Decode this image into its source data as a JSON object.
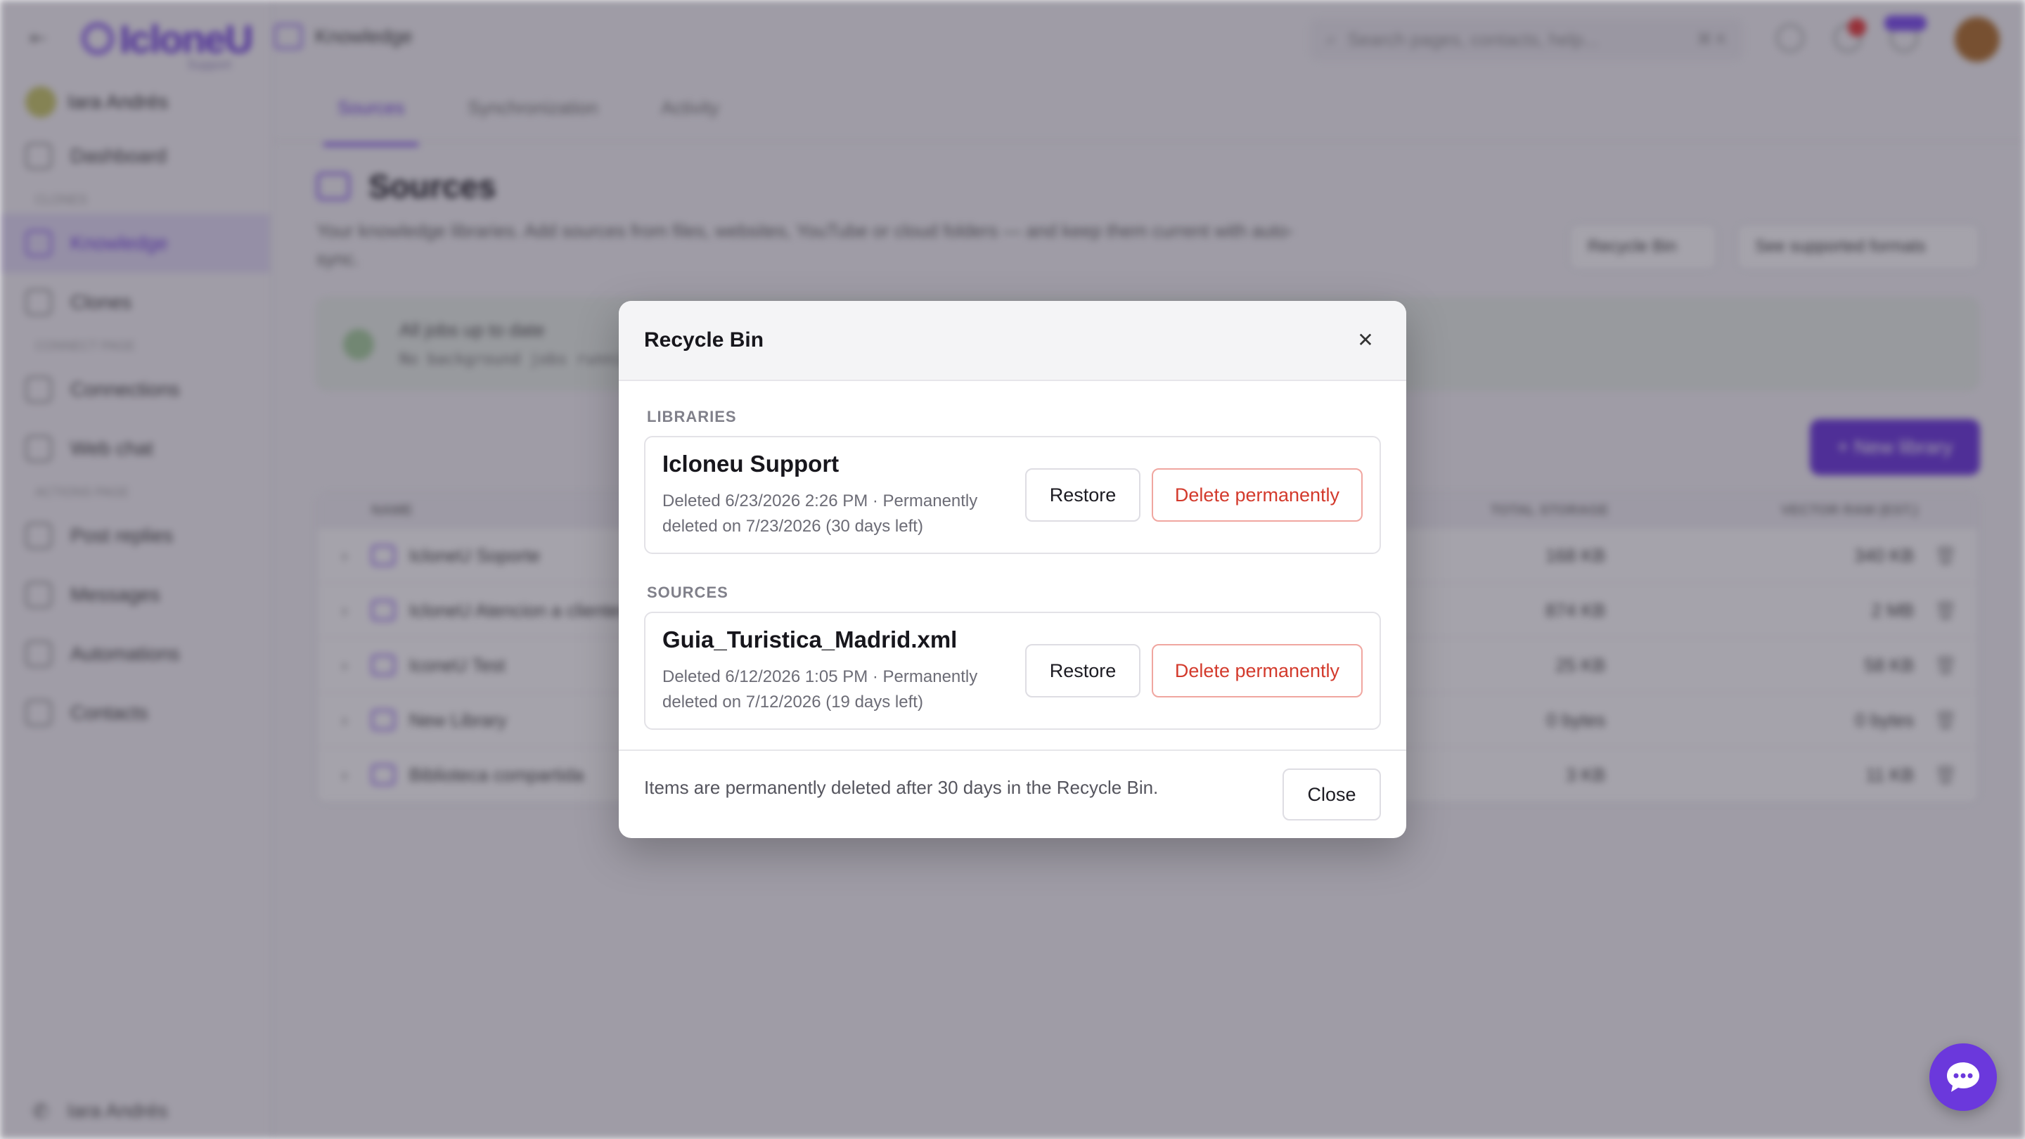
{
  "modal": {
    "title": "Recycle Bin",
    "libraries_label": "LIBRARIES",
    "sources_label": "SOURCES",
    "libraries": [
      {
        "name": "Icloneu Support",
        "meta": "Deleted 6/23/2026 2:26 PM · Permanently deleted on 7/23/2026 (30 days left)",
        "restore_label": "Restore",
        "delete_label": "Delete permanently"
      }
    ],
    "sources": [
      {
        "name": "Guia_Turistica_Madrid.xml",
        "meta": "Deleted 6/12/2026 1:05 PM · Permanently deleted on 7/12/2026 (19 days left)",
        "restore_label": "Restore",
        "delete_label": "Delete permanently"
      }
    ],
    "footer_note": "Items are permanently deleted after 30 days in the Recycle Bin.",
    "close_label": "Close"
  },
  "background": {
    "logo": "IcloneU",
    "logo_sub": "Support",
    "user": "Iara Andrés",
    "breadcrumb": "Knowledge",
    "search_placeholder": "Search pages, contacts, help...",
    "search_kbd": "⌘ K",
    "sidebar": {
      "dashboard": "Dashboard",
      "group_clones": "CLONES",
      "knowledge": "Knowledge",
      "clones": "Clones",
      "group_connect": "CONNECT PAGE",
      "connections": "Connections",
      "webchat": "Web chat",
      "group_actions": "ACTIONS PAGE",
      "post_replies": "Post replies",
      "messages": "Messages",
      "automations": "Automations",
      "contacts": "Contacts"
    },
    "tabs": [
      "Sources",
      "Synchronization",
      "Activity"
    ],
    "page_title": "Sources",
    "page_desc": "Your knowledge libraries. Add sources from files, websites, YouTube or cloud folders — and keep them current with auto-sync.",
    "recycle_btn": "Recycle Bin",
    "formats_btn": "See supported formats",
    "jobs_title": "All jobs up to date",
    "jobs_sub": "No background jobs running",
    "new_library": "+ New library",
    "table_headers": [
      "NAME",
      "TOTAL STORAGE",
      "VECTOR RAM (EST.)"
    ],
    "rows": [
      {
        "name": "IcloneU Soporte",
        "storage": "168 KB",
        "vector": "340 KB"
      },
      {
        "name": "IcloneU Atencion a clientes",
        "storage": "874 KB",
        "vector": "2 MB"
      },
      {
        "name": "IconeU Test",
        "storage": "25 KB",
        "vector": "58 KB"
      },
      {
        "name": "New Library",
        "storage": "0 bytes",
        "vector": "0 bytes"
      },
      {
        "name": "Biblioteca compartida",
        "storage": "3 KB",
        "vector": "11 KB"
      }
    ]
  },
  "colors": {
    "accent": "#6b38dc",
    "danger": "#d33a2c",
    "overlay": "rgba(40,36,56,0.42)"
  }
}
